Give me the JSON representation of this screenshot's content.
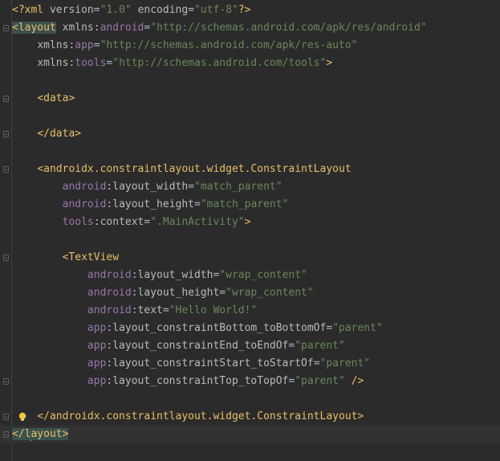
{
  "editor": {
    "language": "xml",
    "colors": {
      "background": "#2b2b2b",
      "tag": "#e8bf6a",
      "attribute": "#bababa",
      "namespace": "#9876aa",
      "value": "#6a8759",
      "text": "#a9b7c6",
      "current_line": "#323232"
    },
    "lines": [
      {
        "fold": false,
        "tokens": [
          {
            "t": "tag",
            "v": "<?xml "
          },
          {
            "t": "attr",
            "v": "version"
          },
          {
            "t": "plain",
            "v": "="
          },
          {
            "t": "val",
            "v": "\"1.0\""
          },
          {
            "t": "plain",
            "v": " "
          },
          {
            "t": "attr",
            "v": "encoding"
          },
          {
            "t": "plain",
            "v": "="
          },
          {
            "t": "val",
            "v": "\"utf-8\""
          },
          {
            "t": "tag",
            "v": "?>"
          }
        ]
      },
      {
        "fold": true,
        "tokens": [
          {
            "t": "tag-hl",
            "v": "<layout"
          },
          {
            "t": "plain",
            "v": " "
          },
          {
            "t": "attr",
            "v": "xmlns:"
          },
          {
            "t": "ns",
            "v": "android"
          },
          {
            "t": "plain",
            "v": "="
          },
          {
            "t": "val",
            "v": "\"http://schemas.android.com/apk/res/android\""
          }
        ]
      },
      {
        "fold": false,
        "tokens": [
          {
            "t": "plain",
            "v": "    "
          },
          {
            "t": "attr",
            "v": "xmlns:"
          },
          {
            "t": "ns",
            "v": "app"
          },
          {
            "t": "plain",
            "v": "="
          },
          {
            "t": "val",
            "v": "\"http://schemas.android.com/apk/res-auto\""
          }
        ]
      },
      {
        "fold": false,
        "tokens": [
          {
            "t": "plain",
            "v": "    "
          },
          {
            "t": "attr",
            "v": "xmlns:"
          },
          {
            "t": "ns",
            "v": "tools"
          },
          {
            "t": "plain",
            "v": "="
          },
          {
            "t": "val",
            "v": "\"http://schemas.android.com/tools\""
          },
          {
            "t": "tag",
            "v": ">"
          }
        ]
      },
      {
        "fold": false,
        "tokens": []
      },
      {
        "fold": true,
        "tokens": [
          {
            "t": "plain",
            "v": "    "
          },
          {
            "t": "tag",
            "v": "<data>"
          }
        ]
      },
      {
        "fold": false,
        "tokens": []
      },
      {
        "fold": true,
        "tokens": [
          {
            "t": "plain",
            "v": "    "
          },
          {
            "t": "tag",
            "v": "</data>"
          }
        ]
      },
      {
        "fold": false,
        "tokens": []
      },
      {
        "fold": true,
        "tokens": [
          {
            "t": "plain",
            "v": "    "
          },
          {
            "t": "tag",
            "v": "<androidx.constraintlayout.widget.ConstraintLayout"
          }
        ]
      },
      {
        "fold": false,
        "tokens": [
          {
            "t": "plain",
            "v": "        "
          },
          {
            "t": "ns",
            "v": "android"
          },
          {
            "t": "attr",
            "v": ":layout_width"
          },
          {
            "t": "plain",
            "v": "="
          },
          {
            "t": "val",
            "v": "\"match_parent\""
          }
        ]
      },
      {
        "fold": false,
        "tokens": [
          {
            "t": "plain",
            "v": "        "
          },
          {
            "t": "ns",
            "v": "android"
          },
          {
            "t": "attr",
            "v": ":layout_height"
          },
          {
            "t": "plain",
            "v": "="
          },
          {
            "t": "val",
            "v": "\"match_parent\""
          }
        ]
      },
      {
        "fold": false,
        "tokens": [
          {
            "t": "plain",
            "v": "        "
          },
          {
            "t": "ns",
            "v": "tools"
          },
          {
            "t": "attr",
            "v": ":context"
          },
          {
            "t": "plain",
            "v": "="
          },
          {
            "t": "val",
            "v": "\".MainActivity\""
          },
          {
            "t": "tag",
            "v": ">"
          }
        ]
      },
      {
        "fold": false,
        "tokens": []
      },
      {
        "fold": true,
        "tokens": [
          {
            "t": "plain",
            "v": "        "
          },
          {
            "t": "tag",
            "v": "<TextView"
          }
        ]
      },
      {
        "fold": false,
        "tokens": [
          {
            "t": "plain",
            "v": "            "
          },
          {
            "t": "ns",
            "v": "android"
          },
          {
            "t": "attr",
            "v": ":layout_width"
          },
          {
            "t": "plain",
            "v": "="
          },
          {
            "t": "val",
            "v": "\"wrap_content\""
          }
        ]
      },
      {
        "fold": false,
        "tokens": [
          {
            "t": "plain",
            "v": "            "
          },
          {
            "t": "ns",
            "v": "android"
          },
          {
            "t": "attr",
            "v": ":layout_height"
          },
          {
            "t": "plain",
            "v": "="
          },
          {
            "t": "val",
            "v": "\"wrap_content\""
          }
        ]
      },
      {
        "fold": false,
        "tokens": [
          {
            "t": "plain",
            "v": "            "
          },
          {
            "t": "ns",
            "v": "android"
          },
          {
            "t": "attr",
            "v": ":text"
          },
          {
            "t": "plain",
            "v": "="
          },
          {
            "t": "val",
            "v": "\"Hello World!\""
          }
        ]
      },
      {
        "fold": false,
        "tokens": [
          {
            "t": "plain",
            "v": "            "
          },
          {
            "t": "ns",
            "v": "app"
          },
          {
            "t": "attr",
            "v": ":layout_constraintBottom_toBottomOf"
          },
          {
            "t": "plain",
            "v": "="
          },
          {
            "t": "val",
            "v": "\"parent\""
          }
        ]
      },
      {
        "fold": false,
        "tokens": [
          {
            "t": "plain",
            "v": "            "
          },
          {
            "t": "ns",
            "v": "app"
          },
          {
            "t": "attr",
            "v": ":layout_constraintEnd_toEndOf"
          },
          {
            "t": "plain",
            "v": "="
          },
          {
            "t": "val",
            "v": "\"parent\""
          }
        ]
      },
      {
        "fold": false,
        "tokens": [
          {
            "t": "plain",
            "v": "            "
          },
          {
            "t": "ns",
            "v": "app"
          },
          {
            "t": "attr",
            "v": ":layout_constraintStart_toStartOf"
          },
          {
            "t": "plain",
            "v": "="
          },
          {
            "t": "val",
            "v": "\"parent\""
          }
        ]
      },
      {
        "fold": true,
        "tokens": [
          {
            "t": "plain",
            "v": "            "
          },
          {
            "t": "ns",
            "v": "app"
          },
          {
            "t": "attr",
            "v": ":layout_constraintTop_toTopOf"
          },
          {
            "t": "plain",
            "v": "="
          },
          {
            "t": "val",
            "v": "\"parent\""
          },
          {
            "t": "plain",
            "v": " "
          },
          {
            "t": "tag",
            "v": "/>"
          }
        ]
      },
      {
        "fold": false,
        "tokens": []
      },
      {
        "fold": true,
        "bulb": true,
        "tokens": [
          {
            "t": "plain",
            "v": "    "
          },
          {
            "t": "tag",
            "v": "</androidx.constraintlayout.widget.ConstraintLayout>"
          }
        ]
      },
      {
        "fold": true,
        "caret": true,
        "tokens": [
          {
            "t": "tag-hl",
            "v": "</l"
          },
          {
            "t": "caret",
            "v": ""
          },
          {
            "t": "tag-hl",
            "v": "ayout>"
          }
        ]
      }
    ]
  }
}
